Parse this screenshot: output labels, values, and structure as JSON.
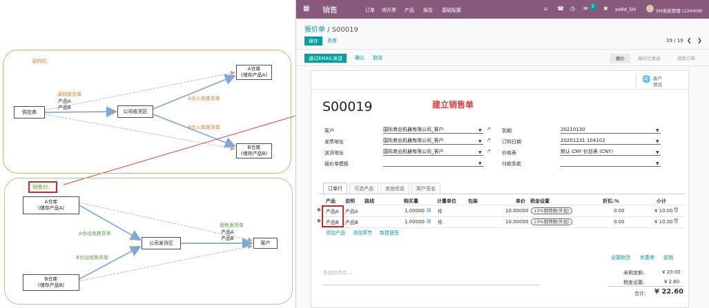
{
  "diagram": {
    "purchase_title": "采购时：",
    "sale_title": "销售时：",
    "supplier": "供应商",
    "company_receive": "公司收货区",
    "warehouse_a_top": [
      "A仓库",
      "(储存产品A)"
    ],
    "warehouse_b_top": [
      "B仓库",
      "(储存产品B)"
    ],
    "purchase_receipt": "采购收货单",
    "product_a": "产品A",
    "product_b": "产品B",
    "a_in_pick": "A仓入库拣货单",
    "b_in_pick": "B仓入库拣货单",
    "warehouse_a_bottom": [
      "A仓库",
      "(储存产品A)"
    ],
    "warehouse_b_bottom": [
      "B仓库",
      "(储存产品B)"
    ],
    "company_ship": "公司发货区",
    "customer": "客户",
    "a_out_pick": "A仓出库拣货单",
    "b_out_pick": "B仓出库拣货单",
    "sale_ship": "销售发货单",
    "product_a2": "产品A",
    "product_b2": "产品B"
  },
  "navbar": {
    "app_name": "销售",
    "menu": [
      "订单",
      "待开票",
      "产品",
      "报告",
      "基础配置"
    ],
    "badge": "1",
    "company": "so8d_SH",
    "user": "SM系统管理 (226408)",
    "colors": {
      "bg": "#875a7b",
      "accent": "#00a09d"
    }
  },
  "breadcrumb": {
    "parent": "报价单",
    "sep": "/",
    "current": "S00019"
  },
  "controls": {
    "save": "保存",
    "discard": "丢弃",
    "pager": "19 / 19"
  },
  "actions": {
    "send_email": "通过EMAIL发送",
    "confirm": "确认",
    "cancel": "取消",
    "stages": [
      "报价",
      "报价已发送",
      "销售订单"
    ]
  },
  "smart_button": {
    "line1": "客户",
    "line2": "预览"
  },
  "annotation": "建立销售单",
  "order": {
    "name": "S00019",
    "left_fields": [
      {
        "label": "客户",
        "value": "国际商业机器有限公司_客户"
      },
      {
        "label": "发票地址",
        "value": "国际商业机器有限公司_客户"
      },
      {
        "label": "送货地址",
        "value": "国际商业机器有限公司_客户"
      },
      {
        "label": "报价单模板",
        "value": ""
      }
    ],
    "right_fields": [
      {
        "label": "到期",
        "value": "20210130"
      },
      {
        "label": "订购日期",
        "value": "20201231 104102"
      },
      {
        "label": "价格表",
        "value": "默认 CNY 价目表 (CNY)"
      },
      {
        "label": "付款条款",
        "value": ""
      }
    ]
  },
  "tabs": [
    "订单行",
    "可选产品",
    "其他信息",
    "客户签名"
  ],
  "lines": {
    "headers": [
      "产品",
      "说明",
      "路线",
      "购买量",
      "计量单位",
      "包装",
      "单价",
      "税金设置",
      "折扣.%",
      "小计"
    ],
    "rows": [
      {
        "product": "产品A",
        "desc": "产品A",
        "qty": "1.00000",
        "uom": "件",
        "price": "10.00000",
        "tax": "13%销项税(外加)",
        "discount": "0.00",
        "subtotal": "¥ 10.00"
      },
      {
        "product": "产品B",
        "desc": "产品B",
        "qty": "1.00000",
        "uom": "件",
        "price": "10.00000",
        "tax": "13%销项税(外加)",
        "discount": "0.00",
        "subtotal": "¥ 10.00"
      }
    ],
    "add_product": "添加产品",
    "add_section": "添加章节",
    "add_note": "新建便签"
  },
  "footer": {
    "links": [
      "设置物流",
      "优惠券",
      "促销"
    ],
    "terms_placeholder": "条款和条件...",
    "untaxed_label": "未税金额:",
    "untaxed_value": "¥ 20.00",
    "tax_label": "税金设置:",
    "tax_value": "¥ 2.60",
    "total_label": "合计:",
    "total_value": "¥ 22.60"
  }
}
